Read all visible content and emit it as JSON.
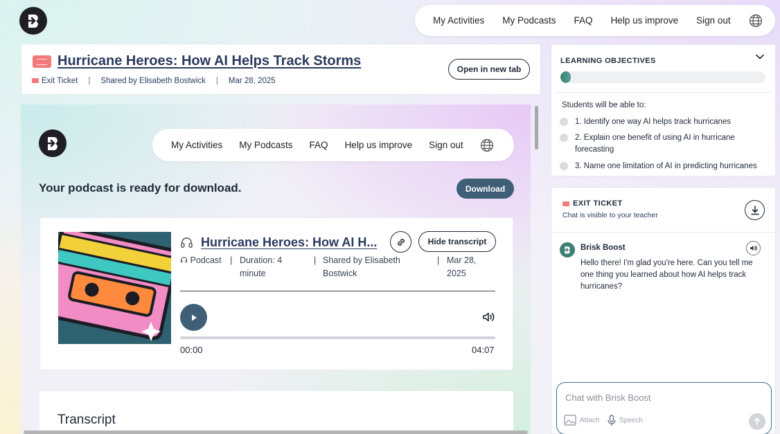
{
  "topnav": {
    "items": [
      "My Activities",
      "My Podcasts",
      "FAQ",
      "Help us improve",
      "Sign out"
    ]
  },
  "activity": {
    "title": "Hurricane Heroes: How AI Helps Track Storms",
    "type_label": "Exit Ticket",
    "shared_by": "Shared by Elisabeth Bostwick",
    "date": "Mar 28, 2025",
    "open_new_tab": "Open in new tab"
  },
  "preview": {
    "nav_items": [
      "My Activities",
      "My Podcasts",
      "FAQ",
      "Help us improve",
      "Sign out"
    ],
    "ready_text": "Your podcast is ready for download.",
    "download_label": "Download",
    "podcast": {
      "title": "Hurricane Heroes: How AI H...",
      "hide_transcript": "Hide transcript",
      "type": "Podcast",
      "duration_line1": "Duration: 4",
      "duration_line2": "minute",
      "shared_line1": "Shared by Elisabeth",
      "shared_line2": "Bostwick",
      "date_line1": "Mar 28,",
      "date_line2": "2025",
      "current_time": "00:00",
      "total_time": "04:07",
      "progress": 0
    },
    "transcript_title": "Transcript"
  },
  "objectives": {
    "heading": "LEARNING OBJECTIVES",
    "progress": 0.05,
    "intro": "Students will be able to:",
    "items": [
      "1. Identify one way AI helps track hurricanes",
      "2. Explain one benefit of using AI in hurricane forecasting",
      "3. Name one limitation of AI in predicting hurricanes"
    ]
  },
  "chat": {
    "heading": "EXIT TICKET",
    "subtitle": "Chat is visible to your teacher",
    "bot_name": "Brisk Boost",
    "bot_message": "Hello there! I'm glad you're here. Can you tell me one thing you learned about how AI helps track hurricanes?",
    "input_placeholder": "Chat with Brisk Boost",
    "attach_label": "Attach",
    "speech_label": "Speech"
  },
  "colors": {
    "accent": "#3f5f77",
    "title": "#2a3a5f",
    "ticket": "#f47a7a",
    "teal": "#3c7f73"
  }
}
